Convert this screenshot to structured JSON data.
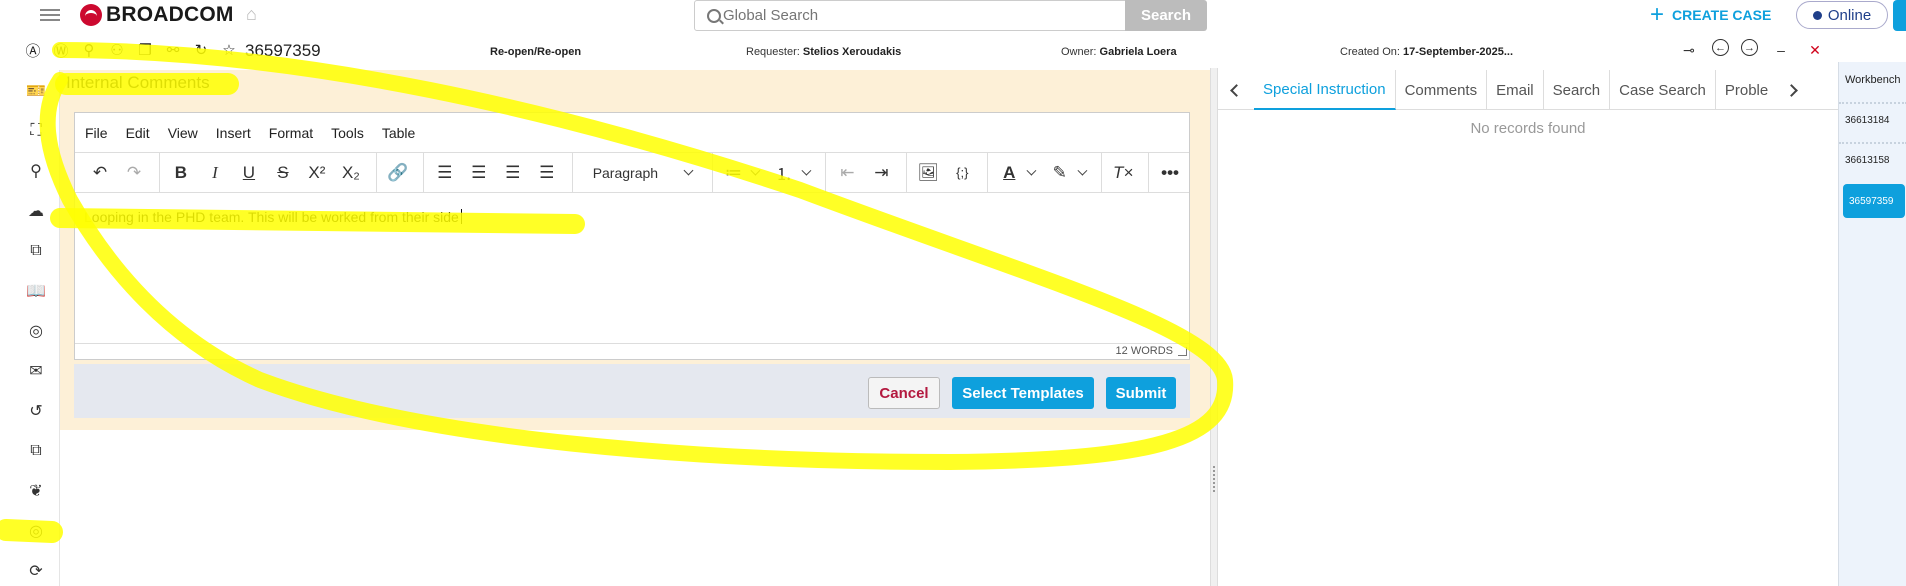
{
  "topbar": {
    "logo_text": "BROADCOM",
    "search_placeholder": "Global Search",
    "search_button": "Search",
    "create_case": "CREATE CASE",
    "status": "Online"
  },
  "casebar": {
    "case_number": "36597359",
    "case_type": "Re-open/Re-open",
    "requester_label": "Requester:",
    "requester": "Stelios Xeroudakis",
    "owner_label": "Owner:",
    "owner": "Gabriela Loera",
    "created_label": "Created On:",
    "created": "17-September-2025..."
  },
  "internal_comments": {
    "title": "Internal Comments",
    "menu": [
      "File",
      "Edit",
      "View",
      "Insert",
      "Format",
      "Tools",
      "Table"
    ],
    "block_format": "Paragraph",
    "content": "Looping in the PHD team. This will be worked from their side",
    "word_count": "12 WORDS",
    "cancel": "Cancel",
    "select_templates": "Select Templates",
    "submit": "Submit"
  },
  "right_panel": {
    "tabs": [
      "Special Instruction",
      "Comments",
      "Email",
      "Search",
      "Case Search",
      "Proble"
    ],
    "active_tab": "Special Instruction",
    "empty_text": "No records found"
  },
  "workbench": {
    "title": "Workbench",
    "items": [
      "36613184",
      "36613158",
      "36597359"
    ],
    "active": "36597359"
  },
  "colors": {
    "accent": "#0ea0dd",
    "brand_red": "#cc092f",
    "panel_bg": "#fdf0d7",
    "highlighter": "#ffff00"
  }
}
